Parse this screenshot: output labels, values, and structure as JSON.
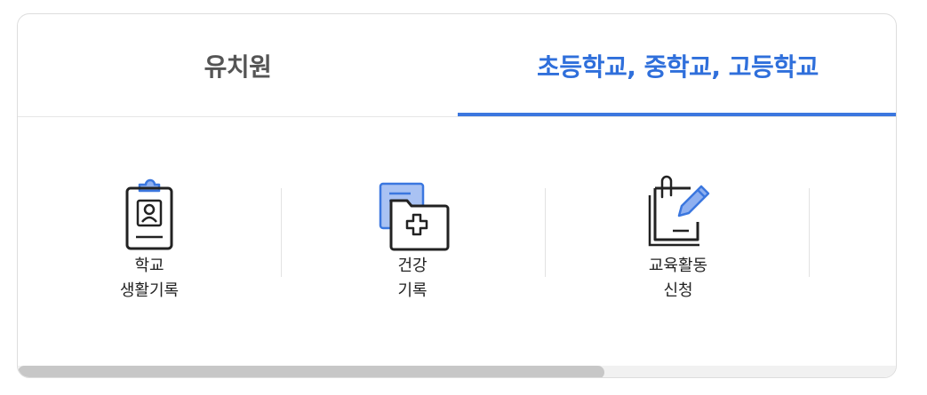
{
  "tabs": [
    {
      "label": "유치원",
      "active": false
    },
    {
      "label": "초등학교, 중학교, 고등학교",
      "active": true
    }
  ],
  "items": [
    {
      "line1": "학교",
      "line2": "생활기록",
      "icon": "clipboard-student-icon"
    },
    {
      "line1": "건강",
      "line2": "기록",
      "icon": "medical-folder-icon"
    },
    {
      "line1": "교육활동",
      "line2": "신청",
      "icon": "document-pencil-icon"
    }
  ],
  "colors": {
    "accent": "#3b77df",
    "active_tab_text": "#2f6fdb",
    "inactive_tab_text": "#555555",
    "icon_stroke": "#222222",
    "icon_fill_blue": "#8fb0f0"
  }
}
